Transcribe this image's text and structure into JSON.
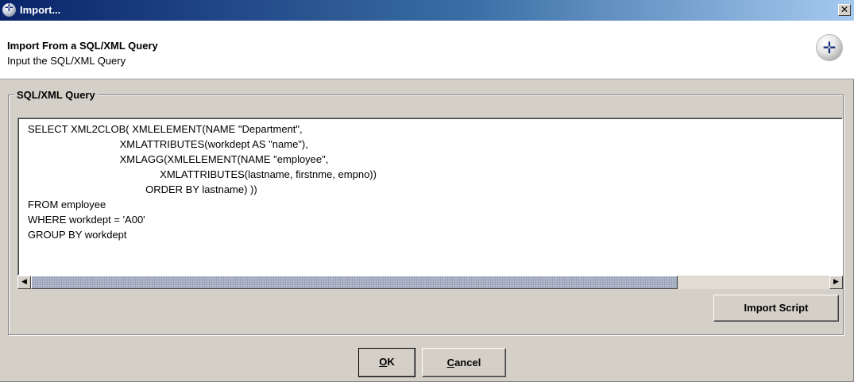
{
  "window": {
    "title": "Import..."
  },
  "header": {
    "title": "Import From a SQL/XML Query",
    "subtitle": "Input the SQL/XML Query"
  },
  "query_group": {
    "legend": "SQL/XML Query",
    "query": "SELECT XML2CLOB( XMLELEMENT(NAME \"Department\",\n                                XMLATTRIBUTES(workdept AS \"name\"),\n                                XMLAGG(XMLELEMENT(NAME \"employee\",\n                                              XMLATTRIBUTES(lastname, firstnme, empno))\n                                         ORDER BY lastname) ))\nFROM employee\nWHERE workdept = 'A00'\nGROUP BY workdept",
    "scroll_position": 0,
    "scroll_visible_fraction": 0.81,
    "import_script_label": "Import Script"
  },
  "buttons": {
    "ok": {
      "mnemonic": "O",
      "rest": "K"
    },
    "cancel": {
      "mnemonic": "C",
      "rest": "ancel"
    }
  },
  "icons": {
    "app": "app-logo-icon",
    "header": "wizard-logo-icon",
    "close": "close-icon",
    "scroll_left": "arrow-left-icon",
    "scroll_right": "arrow-right-icon"
  },
  "colors": {
    "titlebar_start": "#0a246a",
    "titlebar_end": "#a6caf0",
    "dialog_background": "#d4d0c8",
    "scroll_thumb": "#b4bccc"
  }
}
